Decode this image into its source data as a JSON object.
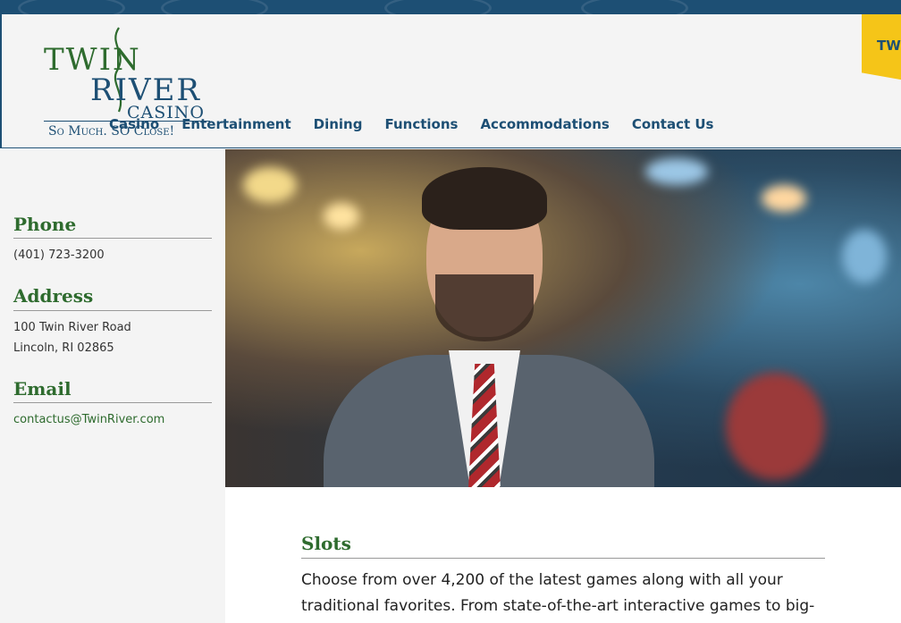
{
  "header": {
    "logo": {
      "line1": "TWIN",
      "line2": "RIVER",
      "line3": "CASINO",
      "tagline": "So Much.   SO Close!"
    },
    "nav": [
      "Casino",
      "Entertainment",
      "Dining",
      "Functions",
      "Accommodations",
      "Contact Us"
    ],
    "badge": "TW"
  },
  "sidebar": {
    "phone_heading": "Phone",
    "phone": "(401) 723-3200",
    "address_heading": "Address",
    "address_line1": "100 Twin River Road",
    "address_line2": "Lincoln, RI 02865",
    "email_heading": "Email",
    "email": "contactus@TwinRiver.com"
  },
  "main": {
    "heading": "Slots",
    "body": "Choose from over 4,200 of the latest games along with all your traditional favorites. From state-of-the-art interactive games to big-"
  },
  "colors": {
    "brand_blue": "#1d4f74",
    "brand_green": "#2e6b2e",
    "badge_yellow": "#f5c518"
  }
}
